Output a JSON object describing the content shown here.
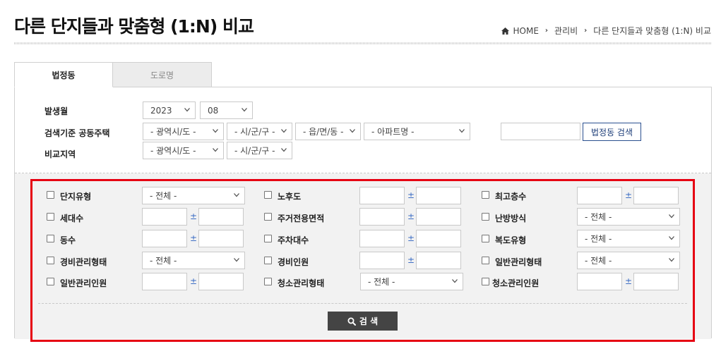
{
  "page": {
    "title": "다른 단지들과 맞춤형 (1:N) 비교"
  },
  "breadcrumb": {
    "home": "HOME",
    "level1": "관리비",
    "level2": "다른 단지들과 맞춤형 (1:N) 비교"
  },
  "tabs": [
    {
      "label": "법정동"
    },
    {
      "label": "도로명"
    }
  ],
  "upper": {
    "month_label": "발생월",
    "year": "2023",
    "month": "08",
    "basis_label": "검색기준 공동주택",
    "basis_selects": [
      "- 광역시/도 -",
      "- 시/군/구 -",
      "- 읍/면/동 -",
      "- 아파트명 -"
    ],
    "search_input_value": "",
    "search_button": "법정동 검색",
    "compare_label": "비교지역",
    "compare_selects": [
      "- 광역시/도 -",
      "- 시/군/구 -"
    ]
  },
  "filters": {
    "plus_minus": "±",
    "select_placeholder": "- 전체 -",
    "items": {
      "complex_type": "단지유형",
      "households": "세대수",
      "buildings": "동수",
      "security_mgmt_type": "경비관리형태",
      "general_mgmt_staff": "일반관리인원",
      "building_age": "노후도",
      "exclusive_area": "주거전용면적",
      "parking": "주차대수",
      "security_staff": "경비인원",
      "cleaning_mgmt_type": "청소관리형태",
      "max_floors": "최고층수",
      "heating": "난방방식",
      "corridor_type": "복도유형",
      "general_mgmt_type": "일반관리형태",
      "cleaning_staff": "청소관리인원"
    }
  },
  "search_button": "검 색",
  "colors": {
    "highlight": "#e60012",
    "link_blue": "#2a4f8f",
    "dark_button": "#444444"
  }
}
